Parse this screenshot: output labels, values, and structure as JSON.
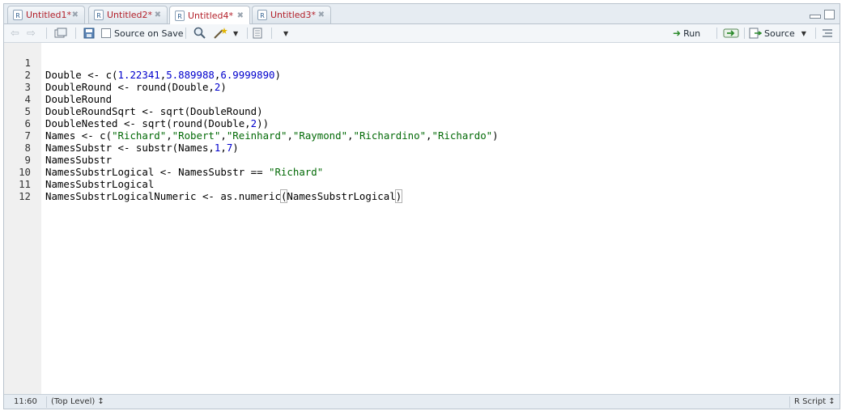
{
  "tabs": [
    {
      "label": "Untitled1*"
    },
    {
      "label": "Untitled2*"
    },
    {
      "label": "Untitled4*",
      "active": true
    },
    {
      "label": "Untitled3*"
    }
  ],
  "toolbar": {
    "source_on_save": "Source on Save",
    "run": "Run",
    "source": "Source"
  },
  "editor": {
    "lines": [
      {
        "number": "1",
        "text": "Double <- c(1.22341,5.889988,6.9999890)"
      },
      {
        "number": "2",
        "text": "DoubleRound <- round(Double,2)"
      },
      {
        "number": "3",
        "text": "DoubleRound"
      },
      {
        "number": "4",
        "text": "DoubleRoundSqrt <- sqrt(DoubleRound)"
      },
      {
        "number": "5",
        "text": "DoubleNested <- sqrt(round(Double,2))"
      },
      {
        "number": "6",
        "text": "Names <- c(\"Richard\",\"Robert\",\"Reinhard\",\"Raymond\",\"Richardino\",\"Richardo\")"
      },
      {
        "number": "7",
        "text": "NamesSubstr <- substr(Names,1,7)"
      },
      {
        "number": "8",
        "text": "NamesSubstr"
      },
      {
        "number": "9",
        "text": "NamesSubstrLogical <- NamesSubstr == \"Richard\""
      },
      {
        "number": "10",
        "text": "NamesSubstrLogical"
      },
      {
        "number": "11",
        "text": "NamesSubstrLogicalNumeric <- as.numeric(NamesSubstrLogical)"
      },
      {
        "number": "12",
        "text": ""
      }
    ]
  },
  "status": {
    "position": "11:60",
    "scope": "(Top Level) ↕",
    "filetype": "R Script ↕"
  },
  "colors": {
    "string": "#036a07",
    "number": "#0000cd",
    "tab_text": "#b3202a"
  }
}
